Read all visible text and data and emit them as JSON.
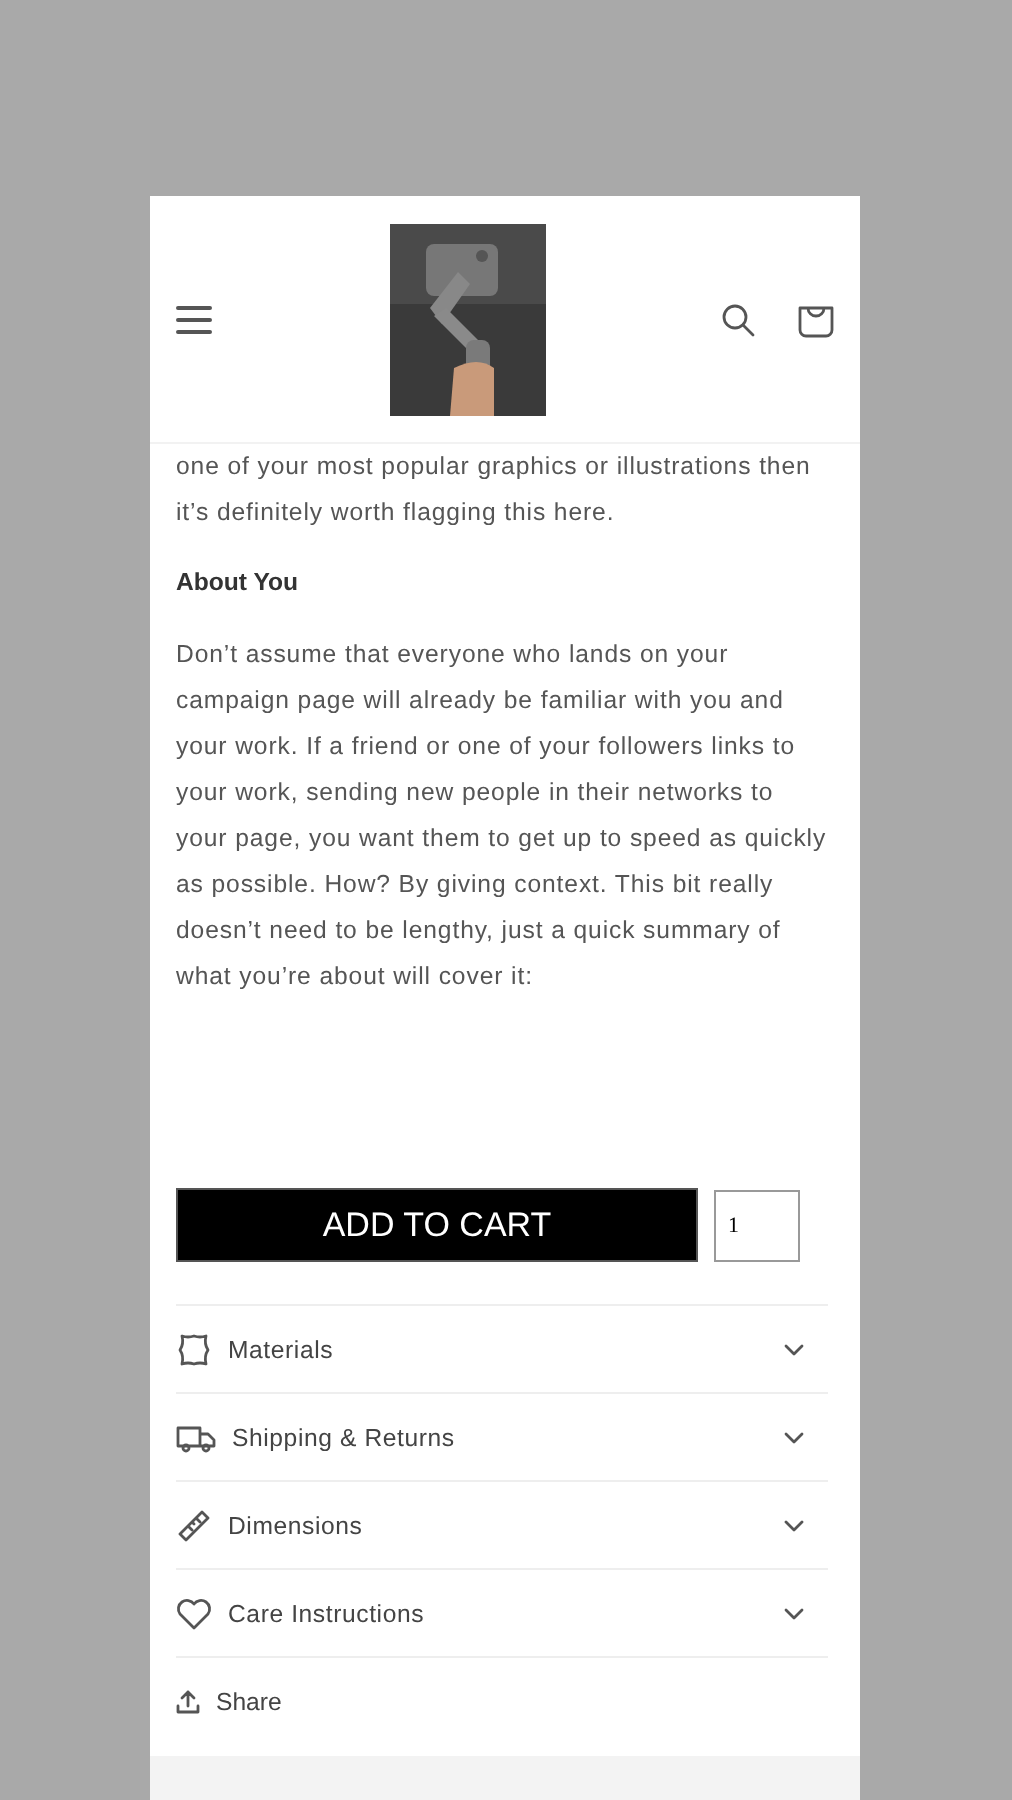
{
  "intro": [
    "one of your most popular graphics or illustrations then it’s definitely worth flagging this here."
  ],
  "section": {
    "heading": "About You",
    "body": "Don’t assume that everyone who lands on your campaign page will already be familiar with you and your work. If a friend or one of your followers links to your work, sending new people in their networks to your page, you want them to get up to speed as quickly as possible. How? By giving context. This bit really doesn’t need to be lengthy, just a quick summary of what you’re about will cover it:"
  },
  "cart": {
    "button": "ADD TO CART",
    "quantity": "1"
  },
  "accordion": [
    {
      "kind": "materials",
      "label": "Materials",
      "expanded": false
    },
    {
      "kind": "shipping",
      "label": "Shipping & Returns",
      "expanded": false
    },
    {
      "kind": "dimensions",
      "label": "Dimensions",
      "expanded": false
    },
    {
      "kind": "care",
      "label": "Care Instructions",
      "expanded": false
    }
  ],
  "share": "Share"
}
